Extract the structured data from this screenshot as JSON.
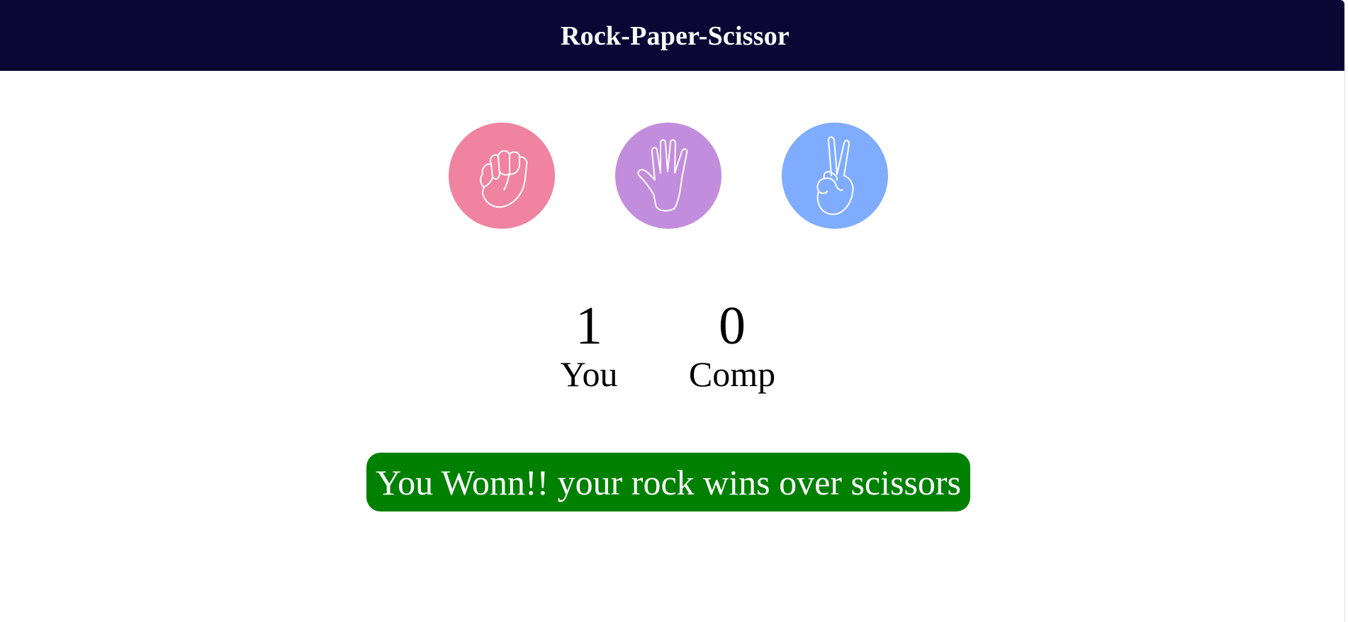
{
  "header": {
    "title": "Rock-Paper-Scissor"
  },
  "choices": [
    {
      "id": "rock",
      "icon": "rock-hand-icon",
      "color": "#ef83a0"
    },
    {
      "id": "paper",
      "icon": "paper-hand-icon",
      "color": "#c38ddd"
    },
    {
      "id": "scissors",
      "icon": "scissors-hand-icon",
      "color": "#80acff"
    }
  ],
  "score": {
    "user_score": "1",
    "user_label": "You",
    "comp_score": "0",
    "comp_label": "Comp"
  },
  "message": {
    "text": "You Wonn!! your rock wins over scissors",
    "color": "#008000"
  },
  "colors": {
    "header_bg": "#0b0634"
  }
}
